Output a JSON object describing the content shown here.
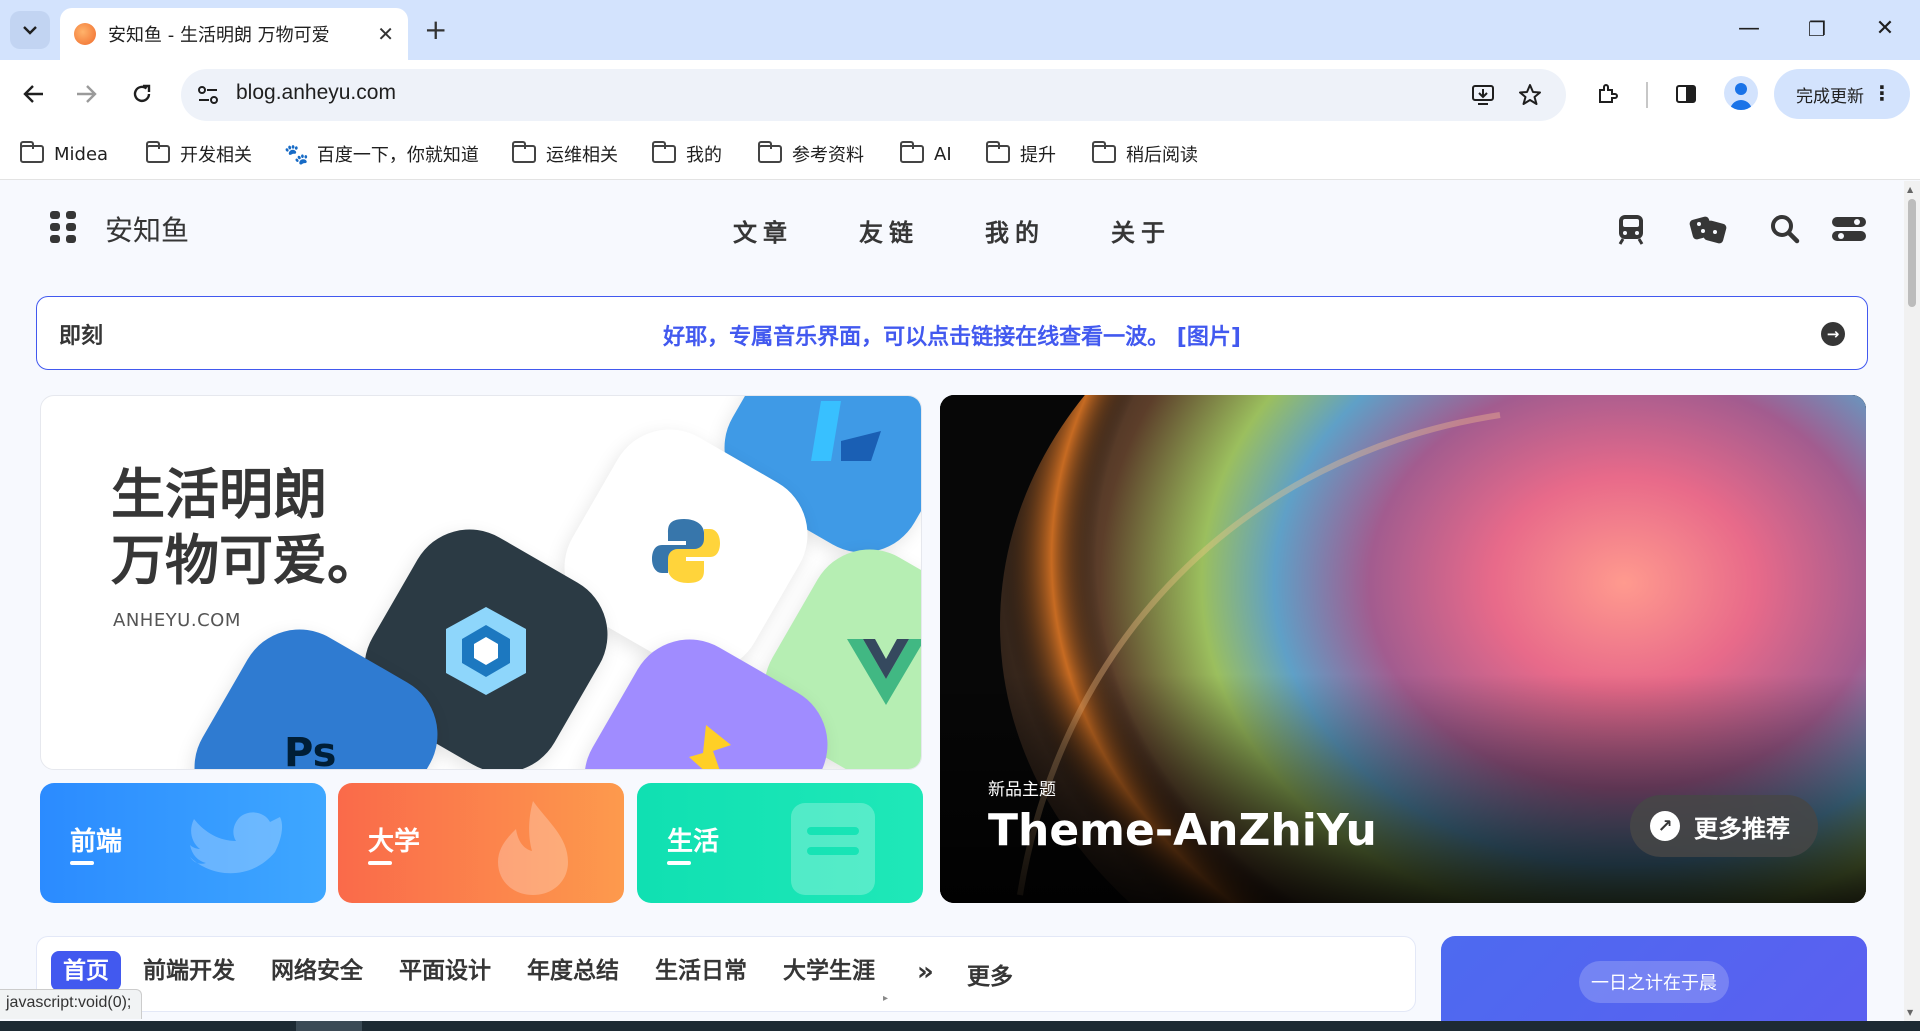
{
  "browser": {
    "tab_title": "安知鱼 - 生活明朗 万物可爱",
    "new_tab": "+",
    "tab_close": "✕",
    "url": "blog.anheyu.com",
    "update_label": "完成更新",
    "window": {
      "minimize": "—",
      "restore": "❐",
      "close": "✕"
    },
    "bookmarks": [
      {
        "label": "Midea",
        "icon": "folder-icon"
      },
      {
        "label": "开发相关",
        "icon": "folder-icon"
      },
      {
        "label": "百度一下，你就知道",
        "icon": "baidu-paw-icon"
      },
      {
        "label": "运维相关",
        "icon": "folder-icon"
      },
      {
        "label": "我的",
        "icon": "folder-icon"
      },
      {
        "label": "参考资料",
        "icon": "folder-icon"
      },
      {
        "label": "AI",
        "icon": "folder-icon"
      },
      {
        "label": "提升",
        "icon": "folder-icon"
      },
      {
        "label": "稍后阅读",
        "icon": "folder-icon"
      }
    ],
    "status_text": "javascript:void(0);"
  },
  "site": {
    "title": "安知鱼",
    "menu": [
      "文章",
      "友链",
      "我的",
      "关于"
    ],
    "right_icons": [
      "train-icon",
      "dice-icon",
      "search-icon",
      "toggle-icon"
    ],
    "bber": {
      "label": "即刻",
      "message": "好耶，专属音乐界面，可以点击链接在线查看一波。 [图片]"
    },
    "hero": {
      "line1": "生活明朗",
      "line2": "万物可爱。",
      "domain": "ANHEYU.COM",
      "app_tiles": [
        "kotlin-icon",
        "python-icon",
        "webpack-icon",
        "vue-icon",
        "photoshop-icon",
        "vite-icon"
      ]
    },
    "categories": [
      {
        "label": "前端",
        "color": "#358bff"
      },
      {
        "label": "大学",
        "color": "#f7744b"
      },
      {
        "label": "生活",
        "color": "#18e7ae"
      }
    ],
    "featured": {
      "subtitle": "新品主题",
      "title": "Theme-AnZhiYu",
      "more": "更多推荐"
    },
    "category_bar": {
      "items": [
        "首页",
        "前端开发",
        "网络安全",
        "平面设计",
        "年度总结",
        "生活日常",
        "大学生涯"
      ],
      "more": "更多"
    },
    "side_card": {
      "pill": "一日之计在于晨"
    }
  },
  "colors": {
    "accent": "#4259ef",
    "chrome_tab": "#d3e3fd",
    "text": "#363636"
  }
}
